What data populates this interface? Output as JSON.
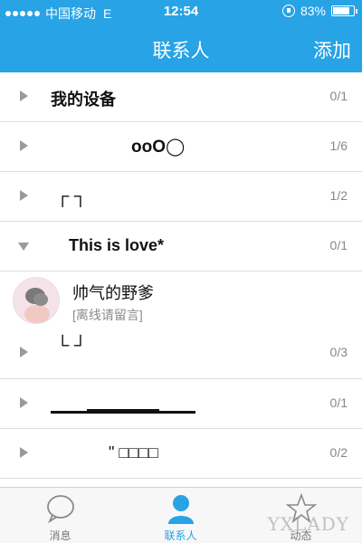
{
  "status_bar": {
    "carrier": "中国移动",
    "network": "E",
    "time": "12:54",
    "battery": "83%",
    "battery_level": 0.83
  },
  "nav": {
    "title": "联系人",
    "add_label": "添加"
  },
  "groups": [
    {
      "name": "我的设备",
      "count": "0/1",
      "expanded": false
    },
    {
      "name": "ooO◯",
      "count": "1/6",
      "expanded": false
    },
    {
      "name": "┌          ┐",
      "count": "1/2",
      "expanded": false
    },
    {
      "name": "This is love*",
      "count": "0/1",
      "expanded": true
    },
    {
      "name": "└          ┘",
      "count": "0/3",
      "expanded": false
    },
    {
      "name": "",
      "count": "0/1",
      "expanded": false
    },
    {
      "name": "\" □□□□",
      "count": "0/2",
      "expanded": false
    }
  ],
  "contact": {
    "name": "帅气的野爹",
    "status": "[离线请留言]"
  },
  "tabs": [
    {
      "label": "消息",
      "icon": "chat-bubble-icon",
      "active": false
    },
    {
      "label": "联系人",
      "icon": "person-icon",
      "active": true
    },
    {
      "label": "动态",
      "icon": "star-icon",
      "active": false
    }
  ],
  "watermark": "YXLADY"
}
